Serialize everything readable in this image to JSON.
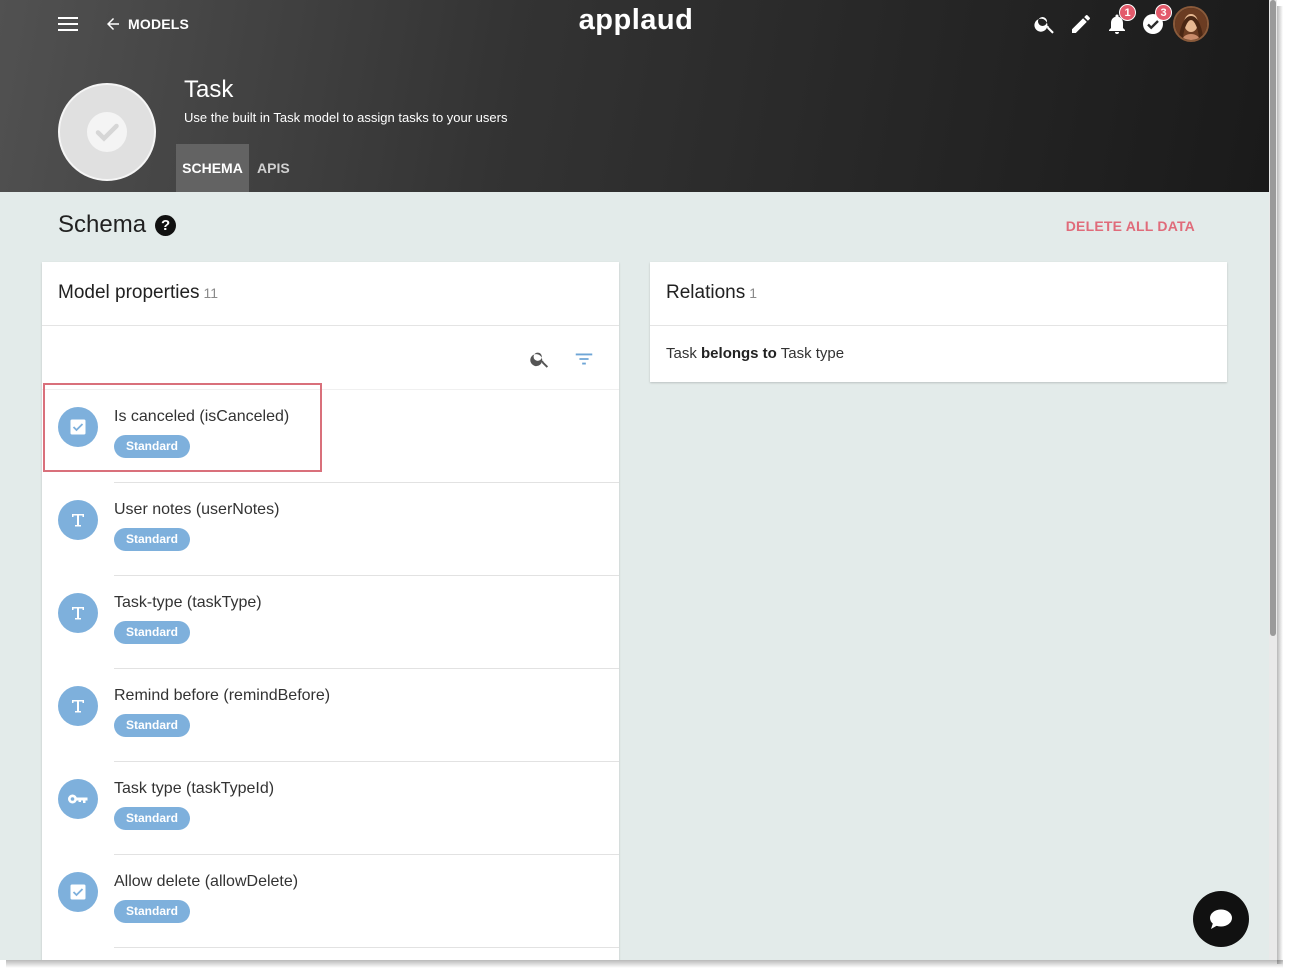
{
  "header": {
    "back_label": "MODELS",
    "logo": "applaud",
    "notifications_count": "1",
    "tasks_count": "3"
  },
  "model": {
    "title": "Task",
    "description": "Use the built in Task model to assign tasks to your users"
  },
  "tabs": [
    {
      "label": "SCHEMA",
      "active": true
    },
    {
      "label": "APIS",
      "active": false
    }
  ],
  "schema": {
    "title": "Schema",
    "help": "?",
    "delete_all_label": "DELETE ALL DATA"
  },
  "model_properties": {
    "title": "Model properties",
    "count": "11",
    "items": [
      {
        "name": "Is canceled (isCanceled)",
        "tag": "Standard",
        "icon": "checkbox-icon"
      },
      {
        "name": "User notes (userNotes)",
        "tag": "Standard",
        "icon": "text-icon"
      },
      {
        "name": "Task-type (taskType)",
        "tag": "Standard",
        "icon": "text-icon"
      },
      {
        "name": "Remind before (remindBefore)",
        "tag": "Standard",
        "icon": "text-icon"
      },
      {
        "name": "Task type (taskTypeId)",
        "tag": "Standard",
        "icon": "key-icon"
      },
      {
        "name": "Allow delete (allowDelete)",
        "tag": "Standard",
        "icon": "checkbox-icon"
      }
    ]
  },
  "relations": {
    "title": "Relations",
    "count": "1",
    "items": [
      {
        "source": "Task",
        "relation": "belongs to",
        "target": "Task type"
      }
    ]
  },
  "colors": {
    "accent_blue": "#7eb0dc",
    "delete_red": "#e06b7a",
    "badge_red": "#e35a6b",
    "highlight_border": "#d9707b"
  }
}
